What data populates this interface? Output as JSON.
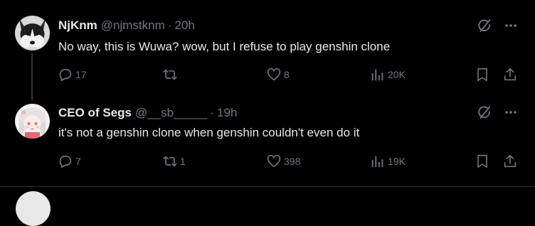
{
  "tweets": [
    {
      "display_name": "NjKnm",
      "handle": "@njmstknm",
      "separator": "·",
      "time": "20h",
      "text": "No way, this is Wuwa? wow, but I refuse to play genshin clone",
      "replies": "17",
      "retweets": "",
      "likes": "8",
      "views": "20K"
    },
    {
      "display_name": "CEO of Segs",
      "handle": "@__sb_____",
      "separator": "·",
      "time": "19h",
      "text": "it's not a genshin clone when genshin couldn't even do it",
      "replies": "7",
      "retweets": "1",
      "likes": "398",
      "views": "19K"
    }
  ],
  "icons": {
    "more": "more-horizontal-icon",
    "grok": "grok-icon",
    "reply": "reply-icon",
    "retweet": "retweet-icon",
    "like": "heart-icon",
    "views": "views-chart-icon",
    "bookmark": "bookmark-icon",
    "share": "share-icon"
  },
  "colors": {
    "background": "#000000",
    "text_primary": "#e7e9ea",
    "text_secondary": "#71767b",
    "divider": "#2f3336"
  }
}
